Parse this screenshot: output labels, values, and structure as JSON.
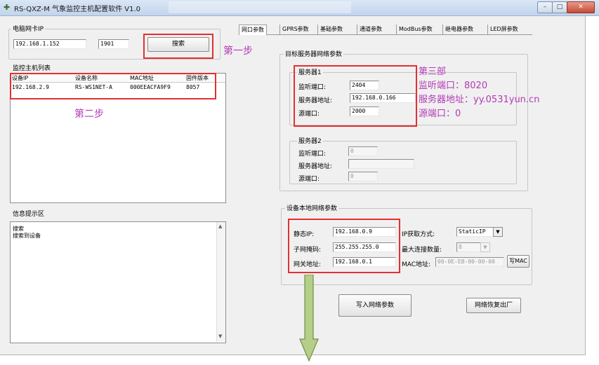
{
  "window": {
    "title": "RS-QXZ-M 气象监控主机配置软件 V1.0",
    "icon": "app-icon",
    "buttons": {
      "minimize": "–",
      "maximize": "□",
      "close": "✕"
    }
  },
  "left": {
    "nic_group_title": "电脑网卡IP",
    "ip_value": "192.168.1.152",
    "port_value": "1901",
    "search_button": "搜索",
    "host_list_title": "监控主机列表",
    "host_list_columns": [
      "设备IP",
      "设备名称",
      "MAC地址",
      "固件版本"
    ],
    "host_list_rows": [
      [
        "192.168.2.9",
        "RS-WS1NET-A",
        "000EEACFA9F9",
        "8057"
      ]
    ],
    "info_title": "信息提示区",
    "info_lines": [
      "搜索",
      "搜索到设备"
    ]
  },
  "tabs": [
    "网口参数",
    "GPRS参数",
    "基础参数",
    "通道参数",
    "ModBus参数",
    "继电器参数",
    "LED屏参数"
  ],
  "target_group": {
    "title": "目标服务器网络参数",
    "server1": {
      "title": "服务器1",
      "listen_port_label": "监听端口:",
      "listen_port": "2404",
      "server_addr_label": "服务器地址:",
      "server_addr": "192.168.0.166",
      "source_port_label": "源端口:",
      "source_port": "2000"
    },
    "server2": {
      "title": "服务器2",
      "listen_port_label": "监听端口:",
      "listen_port": "0",
      "server_addr_label": "服务器地址:",
      "server_addr": "",
      "source_port_label": "源端口:",
      "source_port": "0"
    }
  },
  "local_group": {
    "title": "设备本地网络参数",
    "static_ip_label": "静态IP:",
    "static_ip": "192.168.0.9",
    "subnet_label": "子网掩码:",
    "subnet": "255.255.255.0",
    "gateway_label": "网关地址:",
    "gateway": "192.168.0.1",
    "ip_mode_label": "IP获取方式:",
    "ip_mode": "StaticIP",
    "max_conn_label": "最大连接数量:",
    "max_conn": "8",
    "mac_label": "MAC地址:",
    "mac": "00-0E-EB-00-00-00",
    "write_mac_button": "写MAC"
  },
  "actions": {
    "write_net_button": "写入网络参数",
    "factory_reset_button": "网络恢复出厂"
  },
  "annotations": {
    "step1": "第一步",
    "step2": "第二步",
    "step3_title": "第三部",
    "step3_listen": "监听端口：8020",
    "step3_server": "服务器地址：yy.0531yun.cn",
    "step3_source": "源端口：0"
  },
  "colors": {
    "highlight_red": "#e3302f",
    "annotation_purple": "#b23ab5",
    "arrow_fill": "#b5cf8a",
    "arrow_stroke": "#6f8f43"
  }
}
